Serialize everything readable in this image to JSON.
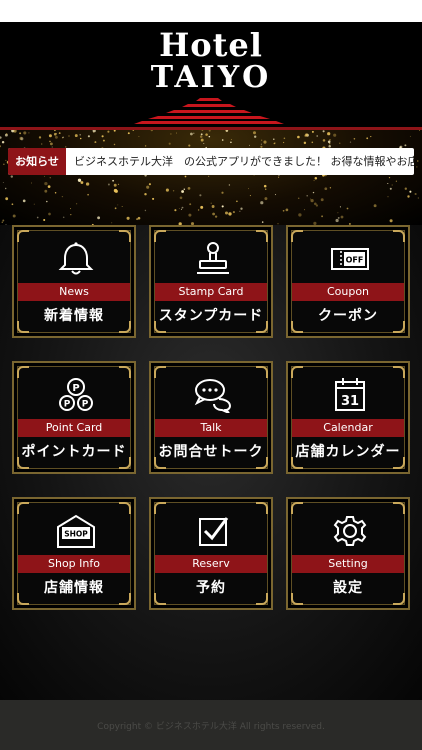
{
  "brand": {
    "line1": "Hotel",
    "line2": "TAIYO"
  },
  "notice": {
    "label": "お知らせ",
    "text": "ビジネスホテル大洋　の公式アプリができました！ お得な情報やお店から"
  },
  "menu": [
    {
      "en": "News",
      "ja": "新着情報",
      "icon": "bell-icon"
    },
    {
      "en": "Stamp Card",
      "ja": "スタンプカード",
      "icon": "stamp-icon"
    },
    {
      "en": "Coupon",
      "ja": "クーポン",
      "icon": "coupon-icon",
      "icon_text": "OFF"
    },
    {
      "en": "Point Card",
      "ja": "ポイントカード",
      "icon": "points-icon"
    },
    {
      "en": "Talk",
      "ja": "お問合せトーク",
      "icon": "chat-icon"
    },
    {
      "en": "Calendar",
      "ja": "店舗カレンダー",
      "icon": "calendar-icon",
      "icon_text": "31"
    },
    {
      "en": "Shop Info",
      "ja": "店舗情報",
      "icon": "shop-icon",
      "icon_text": "SHOP"
    },
    {
      "en": "Reserv",
      "ja": "予約",
      "icon": "checkbox-icon"
    },
    {
      "en": "Setting",
      "ja": "設定",
      "icon": "gear-icon"
    }
  ],
  "footer": {
    "copyright": "Copyright © ビジネスホテル大洋 All rights reserved."
  },
  "colors": {
    "accent_red": "#8e1418",
    "gold_frame": "#c9a85b",
    "background": "#000000"
  }
}
